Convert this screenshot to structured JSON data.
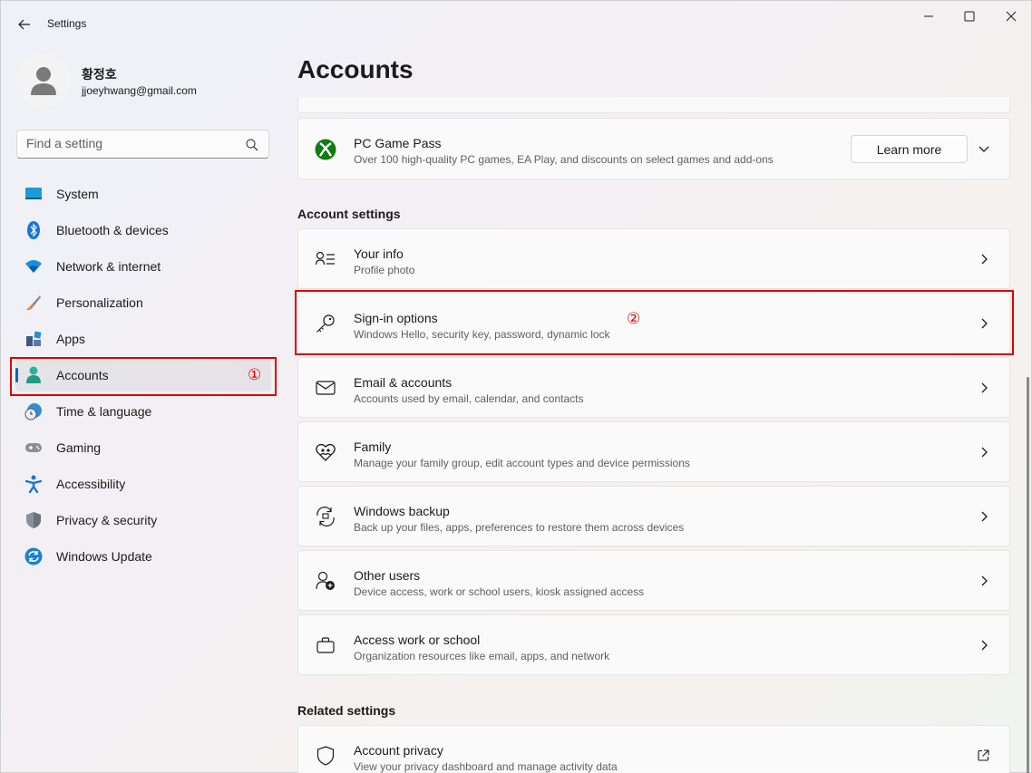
{
  "window": {
    "title": "Settings"
  },
  "profile": {
    "name": "황정호",
    "email": "jjoeyhwang@gmail.com"
  },
  "search": {
    "placeholder": "Find a setting"
  },
  "nav": [
    {
      "label": "System",
      "icon": "system-icon"
    },
    {
      "label": "Bluetooth & devices",
      "icon": "bluetooth-icon"
    },
    {
      "label": "Network & internet",
      "icon": "wifi-icon"
    },
    {
      "label": "Personalization",
      "icon": "brush-icon"
    },
    {
      "label": "Apps",
      "icon": "apps-icon"
    },
    {
      "label": "Accounts",
      "icon": "accounts-icon",
      "selected": true
    },
    {
      "label": "Time & language",
      "icon": "time-language-icon"
    },
    {
      "label": "Gaming",
      "icon": "gamepad-icon"
    },
    {
      "label": "Accessibility",
      "icon": "accessibility-icon"
    },
    {
      "label": "Privacy & security",
      "icon": "shield-icon"
    },
    {
      "label": "Windows Update",
      "icon": "update-icon"
    }
  ],
  "page": {
    "title": "Accounts"
  },
  "gamepass": {
    "title": "PC Game Pass",
    "subtitle": "Over 100 high-quality PC games, EA Play, and discounts on select games and add-ons",
    "button": "Learn more"
  },
  "sections": {
    "account_settings": "Account settings",
    "related_settings": "Related settings"
  },
  "account_settings": [
    {
      "title": "Your info",
      "subtitle": "Profile photo",
      "icon": "person-info-icon"
    },
    {
      "title": "Sign-in options",
      "subtitle": "Windows Hello, security key, password, dynamic lock",
      "icon": "key-icon"
    },
    {
      "title": "Email & accounts",
      "subtitle": "Accounts used by email, calendar, and contacts",
      "icon": "mail-icon"
    },
    {
      "title": "Family",
      "subtitle": "Manage your family group, edit account types and device permissions",
      "icon": "family-icon"
    },
    {
      "title": "Windows backup",
      "subtitle": "Back up your files, apps, preferences to restore them across devices",
      "icon": "backup-icon"
    },
    {
      "title": "Other users",
      "subtitle": "Device access, work or school users, kiosk assigned access",
      "icon": "add-user-icon"
    },
    {
      "title": "Access work or school",
      "subtitle": "Organization resources like email, apps, and network",
      "icon": "briefcase-icon"
    }
  ],
  "related_settings": [
    {
      "title": "Account privacy",
      "subtitle": "View your privacy dashboard and manage activity data",
      "icon": "shield-outline-icon"
    }
  ],
  "annotations": [
    "①",
    "②"
  ],
  "colors": {
    "accent": "#0067c0",
    "highlight": "#e00000",
    "xbox": "#107c10"
  }
}
